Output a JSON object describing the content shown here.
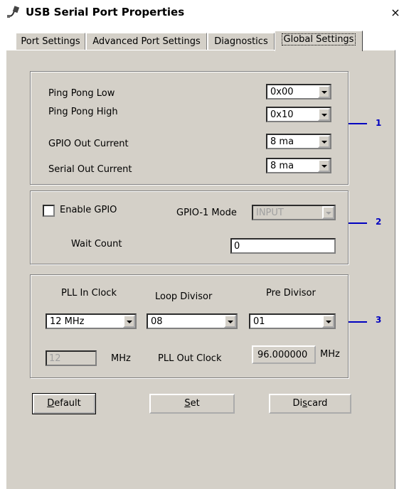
{
  "window": {
    "title": "USB Serial Port Properties",
    "close_glyph": "×"
  },
  "tabs": [
    {
      "label": "Port Settings"
    },
    {
      "label": "Advanced Port Settings"
    },
    {
      "label": "Diagnostics"
    },
    {
      "label": "Global Settings",
      "active": true
    }
  ],
  "group1": {
    "ping_pong_low": {
      "label": "Ping Pong Low",
      "value": "0x00"
    },
    "ping_pong_high": {
      "label": "Ping Pong High",
      "value": "0x10"
    },
    "gpio_out_current": {
      "label": "GPIO Out Current",
      "value": "8 ma"
    },
    "serial_out_current": {
      "label": "Serial Out Current",
      "value": "8 ma"
    },
    "callout": "1"
  },
  "group2": {
    "enable_gpio": {
      "label": "Enable GPIO",
      "checked": false
    },
    "gpio1_mode": {
      "label": "GPIO-1 Mode",
      "value": "INPUT",
      "disabled": true
    },
    "wait_count": {
      "label": "Wait Count",
      "value": "0"
    },
    "callout": "2"
  },
  "group3": {
    "pll_in_clock": {
      "label": "PLL In Clock",
      "value": "12 MHz"
    },
    "loop_divisor": {
      "label": "Loop Divisor",
      "value": "08"
    },
    "pre_divisor": {
      "label": "Pre Divisor",
      "value": "01"
    },
    "in_mhz": {
      "value": "12",
      "unit": "MHz"
    },
    "pll_out_clock": {
      "label": "PLL Out Clock",
      "value": "96.000000",
      "unit": "MHz"
    },
    "callout": "3"
  },
  "buttons": {
    "default": {
      "label_pre": "",
      "label_underline": "D",
      "label_post": "efault"
    },
    "set": {
      "label_pre": "",
      "label_underline": "S",
      "label_post": "et"
    },
    "discard": {
      "label_pre": "Di",
      "label_underline": "s",
      "label_post": "card"
    }
  },
  "colors": {
    "dialog_bg": "#d4d0c8",
    "callout": "#0000c0"
  }
}
